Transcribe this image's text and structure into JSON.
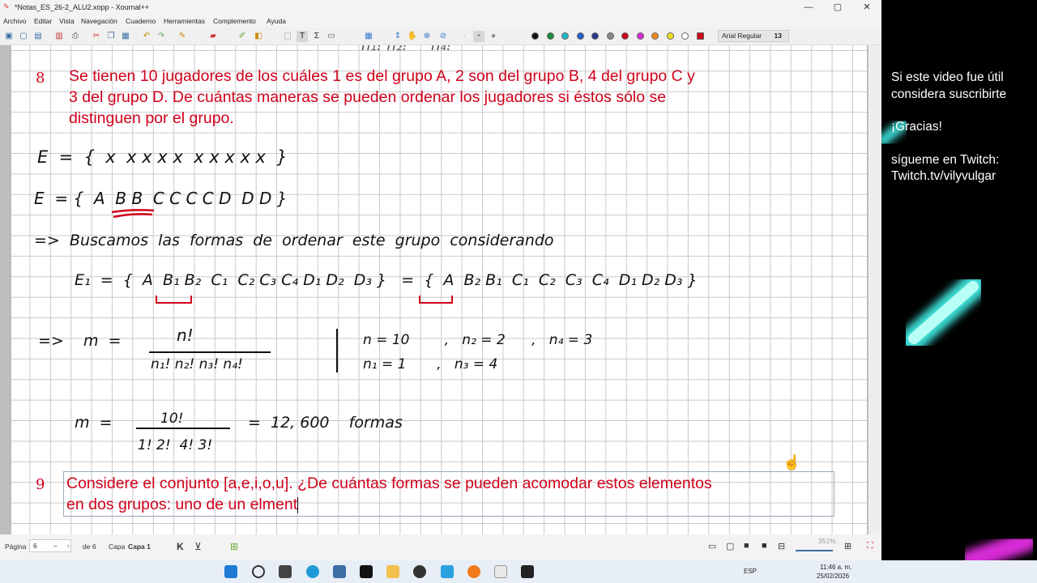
{
  "window": {
    "title": "*Notas_ES_26-2_ALU2.xopp - Xournal++",
    "controls": [
      "—",
      "▢",
      "✕"
    ]
  },
  "menu": [
    "Archivo",
    "Editar",
    "Vista",
    "Navegación",
    "Cuaderno",
    "Herramientas",
    "Complemento",
    "Ayuda"
  ],
  "toolbar": {
    "font_name": "Arial Regular",
    "font_size": "13",
    "pen_colors": [
      "#111111",
      "#1a8a3c",
      "#1fb8c8",
      "#1f5fd0",
      "#2a3a8a",
      "#888888",
      "#d0021b",
      "#d62ad6",
      "#f08a1c",
      "#f0e01c",
      "#ffffff",
      "#d0021b"
    ]
  },
  "notes": {
    "problem8_number": "8",
    "problem8_lines": [
      "Se tienen 10 jugadores de los cuáles 1 es del grupo A, 2 son del grupo B, 4 del grupo C y",
      "3 del grupo D. De cuántas maneras se pueden ordenar los jugadores si éstos sólo se",
      "distinguen por el grupo."
    ],
    "hw_E_set": "E  =  {  x  x x x x  x x x x x  }",
    "hw_E_letters": "E  = {  A  B B  C C C C D  D D }",
    "hw_search": "=>  Buscamos  las  formas  de  ordenar  este  grupo  considerando",
    "hw_E1": "E₁  =  {  A  B₁ B₂  C₁  C₂ C₃ C₄ D₁ D₂  D₃ }   =  {  A  B₂ B₁  C₁  C₂  C₃  C₄  D₁ D₂ D₃ }",
    "hw_m_label": "=>    m  =",
    "hw_m_num": "n!",
    "hw_m_den": "n₁! n₂! n₃! n₄!",
    "hw_vals_1": "n = 10        ,   n₂ = 2      ,   n₄ = 3",
    "hw_vals_2": "n₁ = 1       ,   n₃ = 4",
    "hw_m2_label": "m  =",
    "hw_m2_num": "10!",
    "hw_m2_den": "1! 2!  4! 3!",
    "hw_result": "=  12, 600    formas",
    "problem9_number": "9",
    "problem9_lines": [
      "Considere el conjunto [a,e,i,o,u]. ¿De cuántas formas se pueden acomodar estos elementos",
      "en dos grupos: uno de un elment"
    ]
  },
  "status": {
    "page_label": "Página",
    "page_value": "6",
    "page_total": "de 6",
    "layer_label": "Capa",
    "layer_value": "Capa 1",
    "zoom": "351%"
  },
  "sidebar": {
    "line1": "Si este video fue útil",
    "line2": "considera suscribirte",
    "line3": "¡Gracias!",
    "line4": "sígueme en Twitch:",
    "line5": "Twitch.tv/vilyvulgar"
  },
  "taskbar": {
    "lang": "ESP",
    "time": "11:46 a. m.",
    "date": "25/02/2026"
  }
}
